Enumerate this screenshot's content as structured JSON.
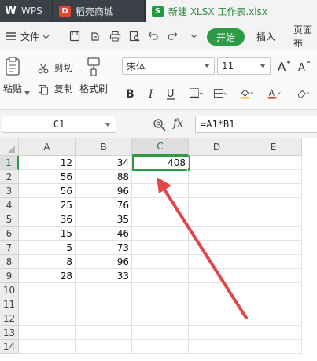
{
  "titlebar": {
    "tabs": [
      {
        "label": "WPS"
      },
      {
        "label": "稻壳商城"
      },
      {
        "label": "新建 XLSX 工作表.xlsx"
      }
    ]
  },
  "menubar": {
    "file_label": "文件",
    "start_label": "开始",
    "insert_label": "插入",
    "page_label": "页面布"
  },
  "ribbon": {
    "paste_label": "粘贴",
    "cut_label": "剪切",
    "copy_label": "复制",
    "format_painter_label": "格式刷",
    "font_name": "宋体",
    "font_size": "11",
    "font_colors": {
      "fill": "#f5c342",
      "text": "#e03030"
    }
  },
  "formulabar": {
    "cell_ref": "C1",
    "fx_label": "fx",
    "formula": "=A1*B1"
  },
  "sheet": {
    "columns": [
      "A",
      "B",
      "C",
      "D",
      "E"
    ],
    "rows": [
      {
        "num": "1",
        "a": "12",
        "b": "34",
        "c": "408"
      },
      {
        "num": "2",
        "a": "56",
        "b": "88",
        "c": ""
      },
      {
        "num": "3",
        "a": "56",
        "b": "96",
        "c": ""
      },
      {
        "num": "4",
        "a": "25",
        "b": "76",
        "c": ""
      },
      {
        "num": "5",
        "a": "36",
        "b": "35",
        "c": ""
      },
      {
        "num": "6",
        "a": "15",
        "b": "46",
        "c": ""
      },
      {
        "num": "7",
        "a": "5",
        "b": "73",
        "c": ""
      },
      {
        "num": "8",
        "a": "8",
        "b": "96",
        "c": ""
      },
      {
        "num": "9",
        "a": "28",
        "b": "33",
        "c": ""
      },
      {
        "num": "10",
        "a": "",
        "b": "",
        "c": ""
      },
      {
        "num": "11",
        "a": "",
        "b": "",
        "c": ""
      },
      {
        "num": "12",
        "a": "",
        "b": "",
        "c": ""
      },
      {
        "num": "13",
        "a": "",
        "b": "",
        "c": ""
      },
      {
        "num": "14",
        "a": "",
        "b": "",
        "c": ""
      }
    ],
    "accent_color": "#2d9a45",
    "annotation_color": "#e04848"
  }
}
